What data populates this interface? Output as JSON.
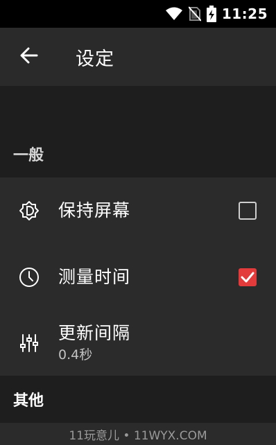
{
  "status_bar": {
    "time": "11:25",
    "icons": [
      "wifi-icon",
      "no-sim-icon",
      "battery-charging-icon"
    ]
  },
  "app_bar": {
    "back_icon": "arrow-back-icon",
    "title": "设定"
  },
  "sections": {
    "general": "一般",
    "other": "其他"
  },
  "settings": {
    "keep_screen": {
      "icon": "brightness-icon",
      "title": "保持屏幕",
      "checked": false
    },
    "measure_time": {
      "icon": "clock-icon",
      "title": "测量时间",
      "checked": true
    },
    "update_interval": {
      "icon": "sliders-icon",
      "title": "更新间隔",
      "value": "0.4秒"
    }
  },
  "watermark": "11玩意儿 • 11WYX.COM",
  "colors": {
    "accent": "#e33b3b",
    "app_bar": "#2a2a2a",
    "list_bg": "#2b2b2b",
    "section_bg": "#1e1e1e"
  }
}
